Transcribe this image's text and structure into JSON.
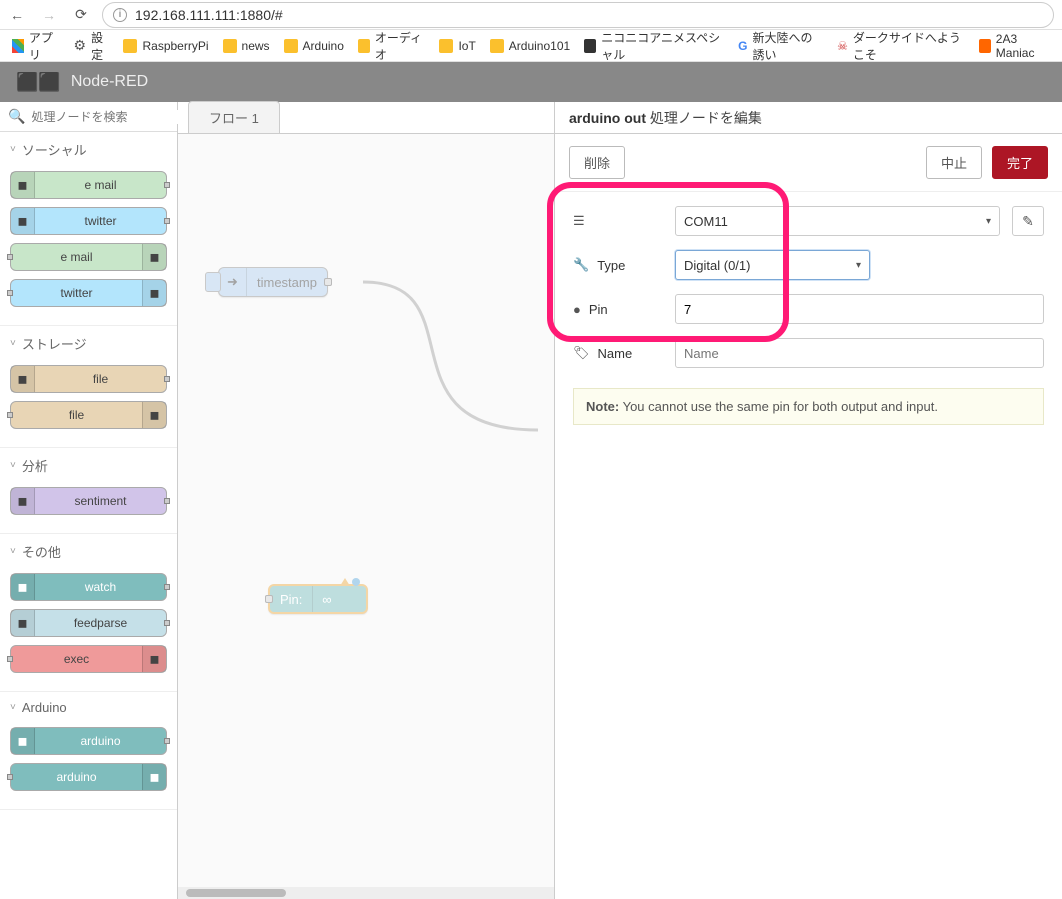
{
  "browser": {
    "url_display": "192.168.111.111:1880/#",
    "url_muted_part": ":1880/#",
    "bookmarks": [
      {
        "label": "アプリ",
        "icon": "apps"
      },
      {
        "label": "設定",
        "icon": "gear"
      },
      {
        "label": "RaspberryPi",
        "icon": "folder"
      },
      {
        "label": "news",
        "icon": "folder"
      },
      {
        "label": "Arduino",
        "icon": "folder"
      },
      {
        "label": "オーディオ",
        "icon": "folder"
      },
      {
        "label": "IoT",
        "icon": "folder"
      },
      {
        "label": "Arduino101",
        "icon": "folder"
      },
      {
        "label": "ニコニコアニメスペシャル",
        "icon": "nico"
      },
      {
        "label": "新大陸への誘い",
        "icon": "g"
      },
      {
        "label": "ダークサイドへようこそ",
        "icon": "star"
      },
      {
        "label": "2A3 Maniac",
        "icon": "blog"
      }
    ]
  },
  "header": {
    "title": "Node-RED"
  },
  "sidebar": {
    "search_placeholder": "処理ノードを検索",
    "categories": [
      {
        "label": "ソーシャル",
        "nodes": [
          {
            "label": "e mail",
            "cls": "c-green",
            "iconSide": "left"
          },
          {
            "label": "twitter",
            "cls": "c-blue",
            "iconSide": "left"
          },
          {
            "label": "e mail",
            "cls": "c-green",
            "iconSide": "right"
          },
          {
            "label": "twitter",
            "cls": "c-blue",
            "iconSide": "right"
          }
        ]
      },
      {
        "label": "ストレージ",
        "nodes": [
          {
            "label": "file",
            "cls": "c-tan",
            "iconSide": "left"
          },
          {
            "label": "file",
            "cls": "c-tan",
            "iconSide": "right"
          }
        ]
      },
      {
        "label": "分析",
        "nodes": [
          {
            "label": "sentiment",
            "cls": "c-purple",
            "iconSide": "left"
          }
        ]
      },
      {
        "label": "その他",
        "nodes": [
          {
            "label": "watch",
            "cls": "c-teal",
            "iconSide": "left"
          },
          {
            "label": "feedparse",
            "cls": "c-lblue",
            "iconSide": "left"
          },
          {
            "label": "exec",
            "cls": "c-red",
            "iconSide": "right"
          }
        ]
      },
      {
        "label": "Arduino",
        "nodes": [
          {
            "label": "arduino",
            "cls": "c-teal",
            "iconSide": "left"
          },
          {
            "label": "arduino",
            "cls": "c-teal",
            "iconSide": "right"
          }
        ]
      }
    ]
  },
  "canvas": {
    "tab_label": "フロー 1",
    "timestamp_label": "timestamp",
    "arduino_label": "Pin:"
  },
  "panel": {
    "title_prefix": "arduino out",
    "title_suffix": " 処理ノードを編集",
    "delete_label": "削除",
    "cancel_label": "中止",
    "done_label": "完了",
    "port_label": "",
    "port_value": "COM11",
    "type_label": "Type",
    "type_value": "Digital (0/1)",
    "pin_label": "Pin",
    "pin_value": "7",
    "name_label": "Name",
    "name_placeholder": "Name",
    "note_label": "Note:",
    "note_text": " You cannot use the same pin for both output and input."
  }
}
